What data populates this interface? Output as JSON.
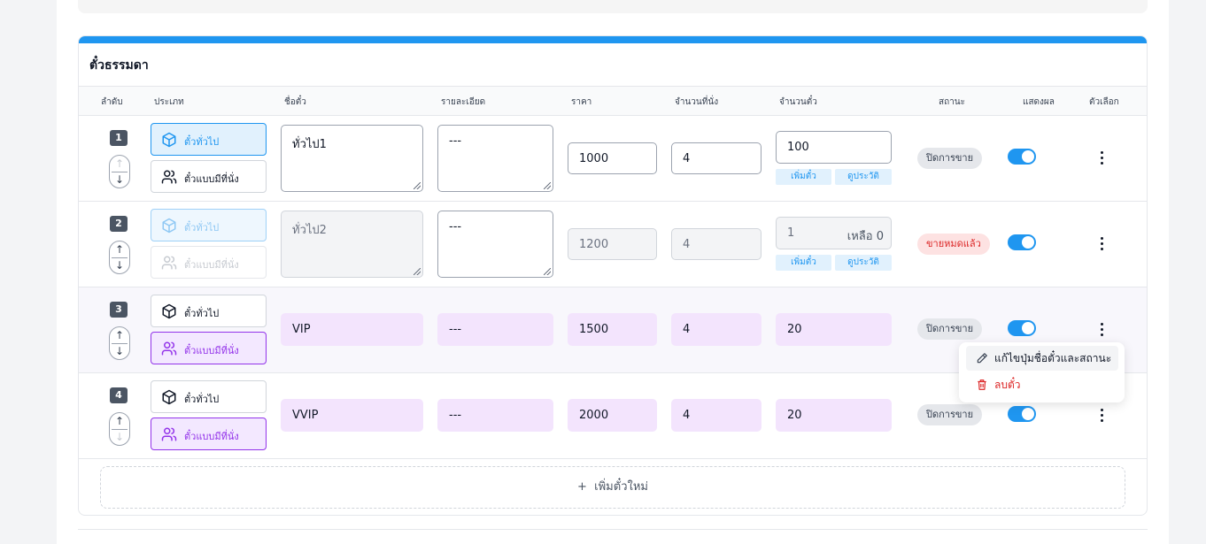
{
  "section": {
    "title": "ตั๋วธรรมดา"
  },
  "columns": [
    "ลำดับ",
    "ประเภท",
    "ชื่อตั๋ว",
    "รายละเอียด",
    "ราคา",
    "จำนวนที่นั่ง",
    "จำนวนตั๋ว",
    "สถานะ",
    "แสดงผล",
    "ตัวเลือก"
  ],
  "type_labels": {
    "general": "ตั๋วทั่วไป",
    "seated": "ตั๋วแบบมีที่นั่ง"
  },
  "rows": [
    {
      "order": "1",
      "selected_type": "general",
      "name": "ทั่วไป1",
      "detail": "---",
      "price": "1000",
      "seats": "4",
      "tickets": "100",
      "add_ticket": "เพิ่มตั๋ว",
      "history": "ดูประวัติ",
      "status": "ปิดการขาย",
      "visible": true
    },
    {
      "order": "2",
      "selected_type": "general",
      "disabled": true,
      "name": "ทั่วไป2",
      "detail": "---",
      "price": "1200",
      "seats": "4",
      "tickets": "1",
      "remaining": "เหลือ 0",
      "add_ticket": "เพิ่มตั๋ว",
      "history": "ดูประวัติ",
      "status": "ขายหมดแล้ว",
      "visible": true
    },
    {
      "order": "3",
      "selected_type": "seated",
      "name": "VIP",
      "detail": "---",
      "price": "1500",
      "seats": "4",
      "tickets": "20",
      "status": "ปิดการขาย",
      "visible": true
    },
    {
      "order": "4",
      "selected_type": "seated",
      "name": "VVIP",
      "detail": "---",
      "price": "2000",
      "seats": "4",
      "tickets": "20",
      "status": "ปิดการขาย",
      "visible": true
    }
  ],
  "context_menu": {
    "edit": "แก้ไขปุ่มชื่อตั๋วและสถานะ",
    "delete": "ลบตั๋ว"
  },
  "add_button": {
    "icon": "+",
    "label": "เพิ่มตั๋วใหม่"
  },
  "colors": {
    "accent": "#1f96f0",
    "purple": "#9333ea",
    "danger": "#dc2626"
  }
}
